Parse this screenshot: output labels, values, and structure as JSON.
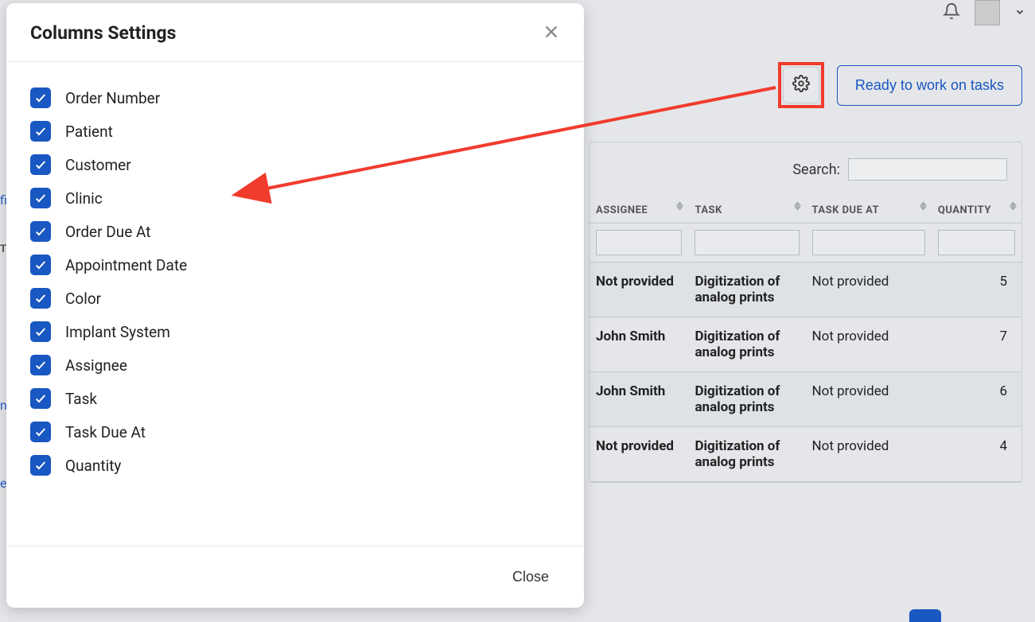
{
  "header": {
    "bell_icon": "bell-icon",
    "avatar": "avatar",
    "chevron": "chevron-down-icon"
  },
  "actions": {
    "gear_icon": "gear-icon",
    "ready_button_label": "Ready to work on tasks"
  },
  "search": {
    "label": "Search:",
    "value": ""
  },
  "table": {
    "columns": [
      "ASSIGNEE",
      "TASK",
      "TASK DUE AT",
      "QUANTITY"
    ],
    "rows": [
      {
        "assignee": "Not provided",
        "task": "Digitization of analog prints",
        "due": "Not provided",
        "qty": "5"
      },
      {
        "assignee": "John Smith",
        "task": "Digitization of analog prints",
        "due": "Not provided",
        "qty": "7"
      },
      {
        "assignee": "John Smith",
        "task": "Digitization of analog prints",
        "due": "Not provided",
        "qty": "6"
      },
      {
        "assignee": "Not provided",
        "task": "Digitization of analog prints",
        "due": "Not provided",
        "qty": "4"
      }
    ]
  },
  "modal": {
    "title": "Columns Settings",
    "close_label": "Close",
    "items": [
      "Order Number",
      "Patient",
      "Customer",
      "Clinic",
      "Order Due At",
      "Appointment Date",
      "Color",
      "Implant System",
      "Assignee",
      "Task",
      "Task Due At",
      "Quantity"
    ]
  },
  "edge_peek": {
    "t": "T",
    "fi": "fi",
    "n": "n",
    "er": "er"
  },
  "colors": {
    "accent": "#1957c2",
    "annotation": "#f13b2d"
  }
}
